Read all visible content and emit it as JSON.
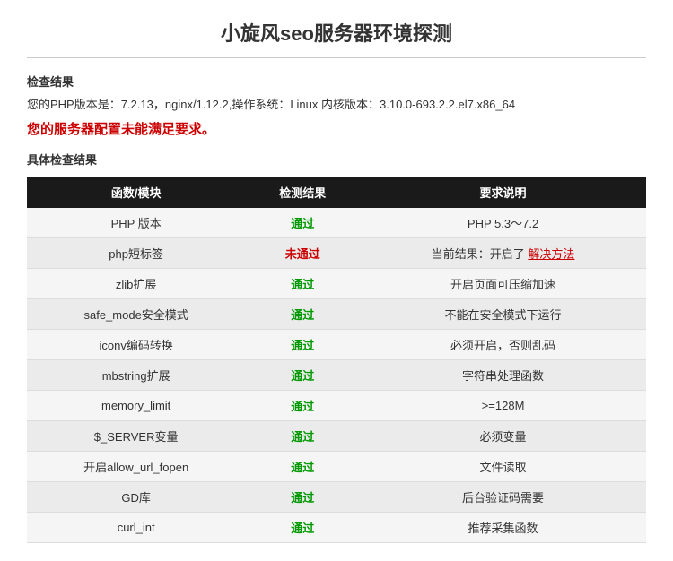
{
  "page": {
    "title": "小旋风seo服务器环境探测",
    "check_label": "检查结果",
    "info_line": "您的PHP版本是：7.2.13，nginx/1.12.2,操作系统：Linux 内核版本：3.10.0-693.2.2.el7.x86_64",
    "warning_line": "您的服务器配置未能满足要求。",
    "detail_label": "具体检查结果",
    "table": {
      "headers": [
        "函数/模块",
        "检测结果",
        "要求说明"
      ],
      "rows": [
        {
          "name": "PHP 版本",
          "result": "通过",
          "result_type": "pass",
          "desc": "PHP 5.3～7.2",
          "desc_link": null
        },
        {
          "name": "php短标签",
          "result": "未通过",
          "result_type": "fail",
          "desc": "当前结果：开启了 解决方法",
          "desc_link": "解决方法"
        },
        {
          "name": "zlib扩展",
          "result": "通过",
          "result_type": "pass",
          "desc": "开启页面可压缩加速",
          "desc_link": null
        },
        {
          "name": "safe_mode安全模式",
          "result": "通过",
          "result_type": "pass",
          "desc": "不能在安全模式下运行",
          "desc_link": null
        },
        {
          "name": "iconv编码转换",
          "result": "通过",
          "result_type": "pass",
          "desc": "必须开启，否则乱码",
          "desc_link": null
        },
        {
          "name": "mbstring扩展",
          "result": "通过",
          "result_type": "pass",
          "desc": "字符串处理函数",
          "desc_link": null
        },
        {
          "name": "memory_limit",
          "result": "通过",
          "result_type": "pass",
          "desc": ">=128M",
          "desc_link": null
        },
        {
          "name": "$_SERVER变量",
          "result": "通过",
          "result_type": "pass",
          "desc": "必须变量",
          "desc_link": null
        },
        {
          "name": "开启allow_url_fopen",
          "result": "通过",
          "result_type": "pass",
          "desc": "文件读取",
          "desc_link": null
        },
        {
          "name": "GD库",
          "result": "通过",
          "result_type": "pass",
          "desc": "后台验证码需要",
          "desc_link": null
        },
        {
          "name": "curl_int",
          "result": "通过",
          "result_type": "pass",
          "desc": "推荐采集函数",
          "desc_link": null
        }
      ]
    }
  }
}
